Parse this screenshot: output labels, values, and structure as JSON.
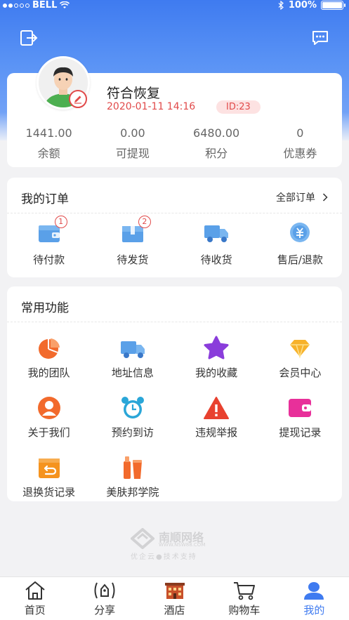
{
  "status_bar": {
    "carrier": "BELL",
    "battery": "100%"
  },
  "profile": {
    "nickname": "符合恢复",
    "register_time": "2020-01-11 14:16",
    "id_badge": "ID:23",
    "stats": [
      {
        "value": "1441.00",
        "label": "余额"
      },
      {
        "value": "0.00",
        "label": "可提现"
      },
      {
        "value": "6480.00",
        "label": "积分"
      },
      {
        "value": "0",
        "label": "优惠券"
      }
    ]
  },
  "orders": {
    "title": "我的订单",
    "all_link": "全部订单",
    "items": [
      {
        "label": "待付款",
        "badge": "1",
        "icon": "wallet-icon"
      },
      {
        "label": "待发货",
        "badge": "2",
        "icon": "package-icon"
      },
      {
        "label": "待收货",
        "badge": "",
        "icon": "truck-icon"
      },
      {
        "label": "售后/退款",
        "badge": "",
        "icon": "refund-icon"
      }
    ]
  },
  "functions": {
    "title": "常用功能",
    "items": [
      {
        "label": "我的团队",
        "icon": "pie-chart-icon"
      },
      {
        "label": "地址信息",
        "icon": "truck-icon"
      },
      {
        "label": "我的收藏",
        "icon": "star-icon"
      },
      {
        "label": "会员中心",
        "icon": "diamond-icon"
      },
      {
        "label": "关于我们",
        "icon": "person-icon"
      },
      {
        "label": "预约到访",
        "icon": "alarm-clock-icon"
      },
      {
        "label": "违规举报",
        "icon": "warning-icon"
      },
      {
        "label": "提现记录",
        "icon": "wallet-icon"
      },
      {
        "label": "退换货记录",
        "icon": "return-box-icon"
      },
      {
        "label": "美肤邦学院",
        "icon": "cosmetics-icon"
      }
    ]
  },
  "watermark": {
    "name": "南顺网络",
    "url": "WWW.NSW88.COM",
    "slogan": "优企云●技术支持"
  },
  "tabbar": {
    "items": [
      {
        "label": "首页",
        "icon": "home-icon"
      },
      {
        "label": "分享",
        "icon": "share-icon"
      },
      {
        "label": "酒店",
        "icon": "hotel-icon"
      },
      {
        "label": "购物车",
        "icon": "cart-icon"
      },
      {
        "label": "我的",
        "icon": "user-icon"
      }
    ],
    "active_index": 4,
    "active_color": "#3f7bf0"
  },
  "colors": {
    "accent": "#3f7bf0",
    "highlight_red": "#e14a4a",
    "orange": "#f26a2c"
  }
}
